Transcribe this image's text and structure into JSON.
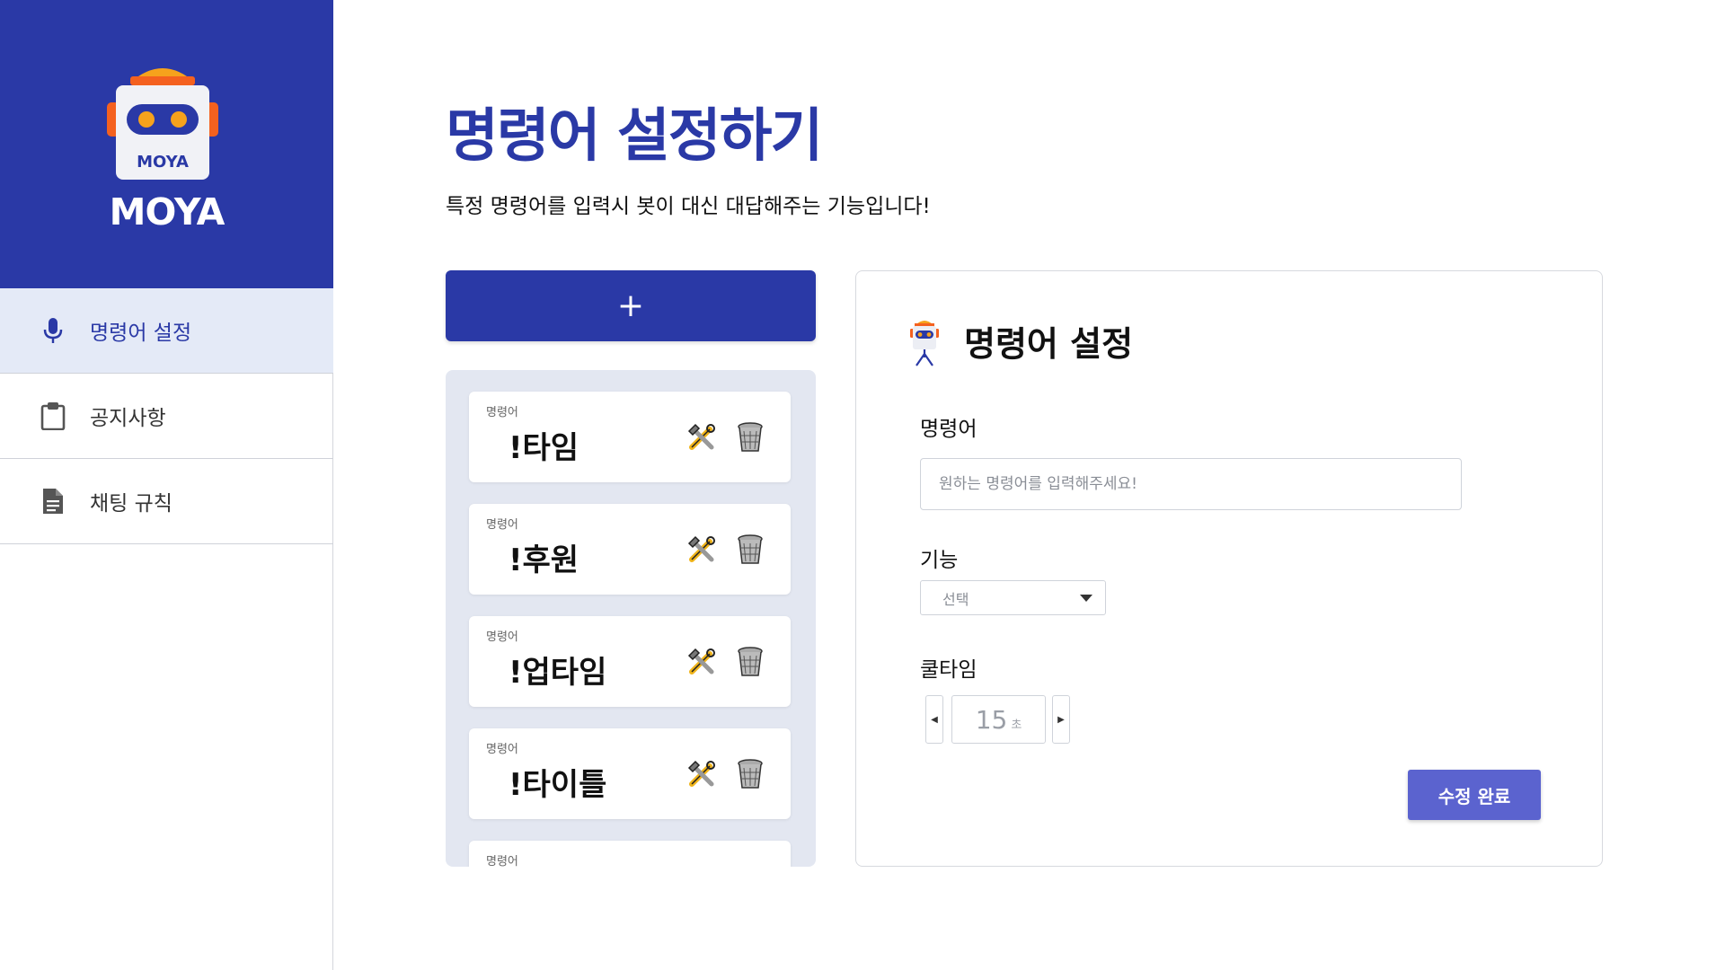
{
  "brand": {
    "name": "MOYA",
    "logo_text": "MOYA",
    "color": "#2a39a6"
  },
  "sidebar": {
    "items": [
      {
        "label": "명령어 설정",
        "icon": "microphone-icon",
        "active": true
      },
      {
        "label": "공지사항",
        "icon": "clipboard-icon",
        "active": false
      },
      {
        "label": "채팅 규칙",
        "icon": "document-icon",
        "active": false
      }
    ]
  },
  "main": {
    "title": "명령어 설정하기",
    "description": "특정 명령어를 입력시 봇이 대신 대답해주는 기능입니다!",
    "add_button_label": "+"
  },
  "commands": {
    "label": "명령어",
    "items": [
      {
        "label": "명령어",
        "name": "!타임",
        "edit_icon": "tools-icon",
        "delete_icon": "trash-icon"
      },
      {
        "label": "명령어",
        "name": "!후원",
        "edit_icon": "tools-icon",
        "delete_icon": "trash-icon"
      },
      {
        "label": "명령어",
        "name": "!업타임",
        "edit_icon": "tools-icon",
        "delete_icon": "trash-icon"
      },
      {
        "label": "명령어",
        "name": "!타이틀",
        "edit_icon": "tools-icon",
        "delete_icon": "trash-icon"
      },
      {
        "label": "명령어",
        "name": "",
        "edit_icon": "tools-icon",
        "delete_icon": "trash-icon"
      }
    ]
  },
  "settings": {
    "title": "명령어 설정",
    "command_label": "명령어",
    "command_placeholder": "원하는 명령어를 입력해주세요!",
    "command_value": "",
    "function_label": "기능",
    "function_selected": "선택",
    "cooldown_label": "쿨타임",
    "cooldown_value": "15",
    "cooldown_unit": "초",
    "save_label": "수정 완료"
  },
  "colors": {
    "primary": "#2a39a6",
    "save_button": "#5b63cf",
    "active_nav_bg": "#e4eaf7",
    "list_bg": "#e3e7f1"
  }
}
